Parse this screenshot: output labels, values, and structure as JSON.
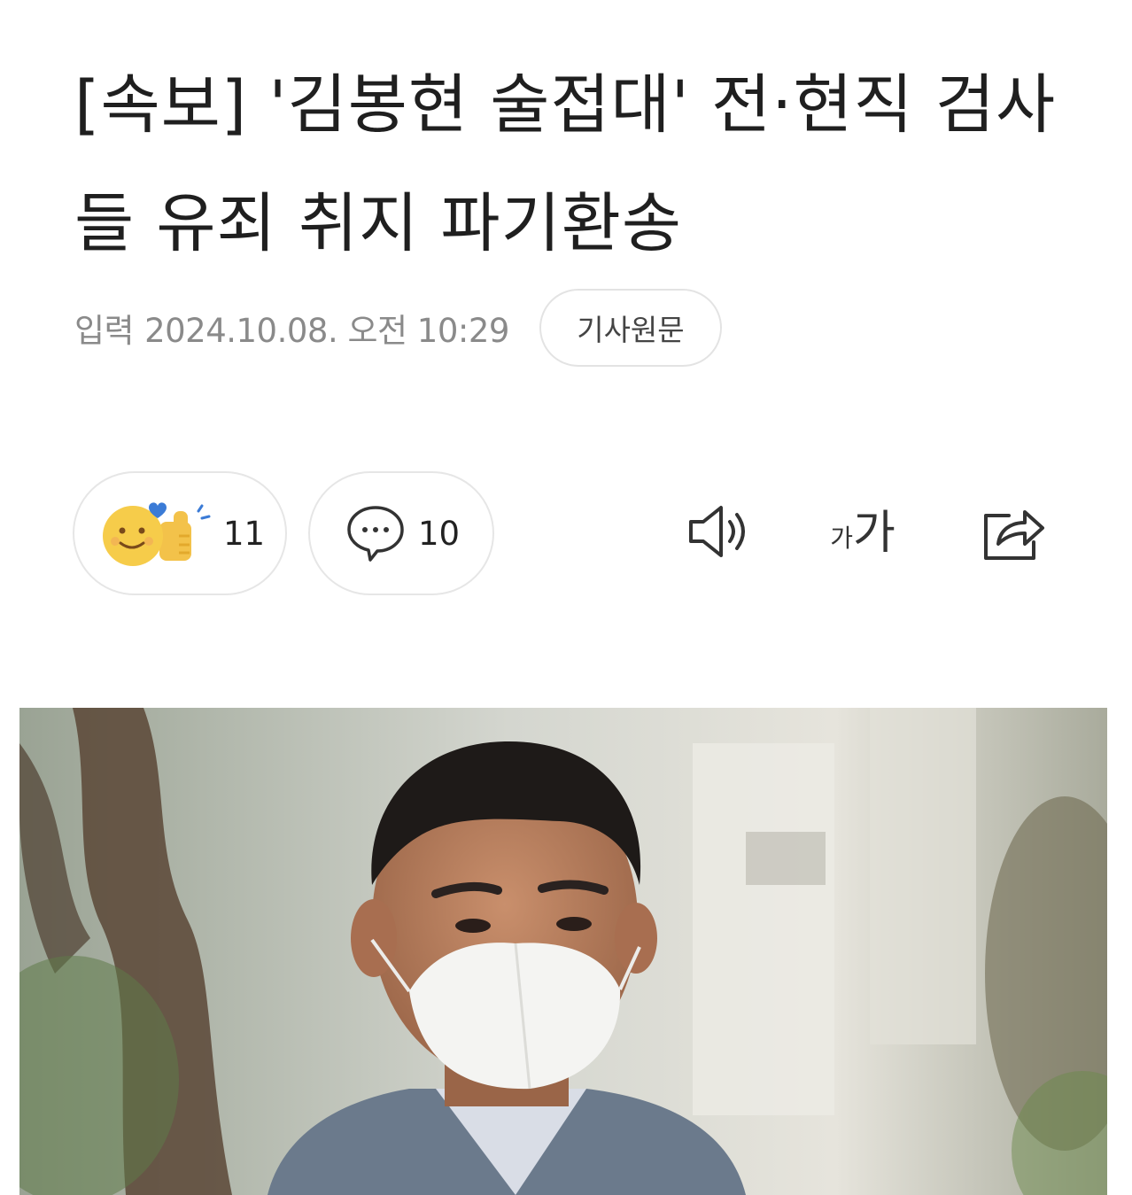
{
  "article": {
    "headline": "[속보] '김봉현 술접대' 전·현직 검사들 유죄 취지 파기환송",
    "meta": {
      "input_label": "입력",
      "date": "2024.10.08. 오전 10:29",
      "original_button_label": "기사원문"
    }
  },
  "actions": {
    "reactions": {
      "icon": "emoji-reaction-icon",
      "count": "11"
    },
    "comments": {
      "icon": "comment-icon",
      "count": "10"
    },
    "toolbar": {
      "speaker_icon": "speaker-icon",
      "font_size_small": "가",
      "font_size_large": "가",
      "share_icon": "share-icon"
    }
  },
  "colors": {
    "text_primary": "#1f1f1f",
    "text_meta": "#8a8a8a",
    "border": "#e3e3e3",
    "emoji_yellow": "#f6cc4a",
    "heart_blue": "#3b7bd6"
  }
}
